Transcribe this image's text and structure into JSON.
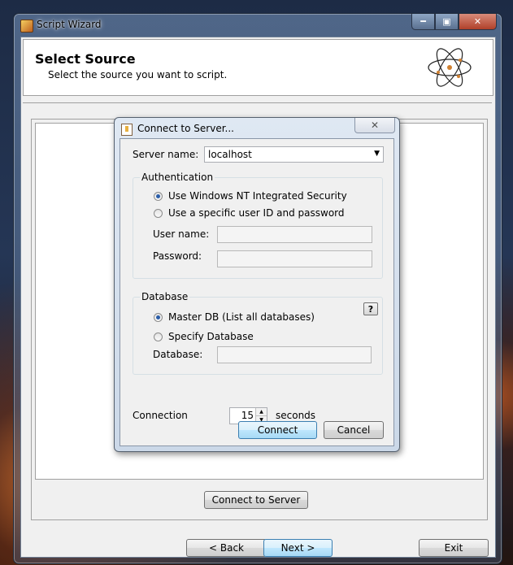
{
  "window": {
    "title": "Script Wizard",
    "minimize_glyph": "━",
    "maximize_glyph": "▣",
    "close_glyph": "✕"
  },
  "header": {
    "title": "Select Source",
    "subtitle": "Select the source you want to script.",
    "icon": "atom-icon"
  },
  "dialog": {
    "title": "Connect to Server...",
    "close_glyph": "✕",
    "server_name_label": "Server name:",
    "server_name_value": "localhost",
    "authentication": {
      "title": "Authentication",
      "option_windows": "Use Windows NT Integrated Security",
      "option_specific": "Use a specific user ID and password",
      "selected": "windows",
      "username_label": "User name:",
      "username_value": "",
      "password_label": "Password:",
      "password_value": ""
    },
    "database": {
      "title": "Database",
      "option_master": "Master DB (List all databases)",
      "option_specify": "Specify Database",
      "selected": "master",
      "database_label": "Database:",
      "database_value": "",
      "help_label": "?"
    },
    "connection": {
      "label": "Connection",
      "timeout_value": "15",
      "unit": "seconds"
    },
    "connect_button": "Connect",
    "cancel_button": "Cancel"
  },
  "main": {
    "connect_to_server_button": "Connect to Server"
  },
  "footer": {
    "back_button": "< Back",
    "next_button": "Next >",
    "exit_button": "Exit"
  },
  "colors": {
    "accent_default_button": "#3c7fb1",
    "dialog_frame": "#cbd8e8",
    "client_background": "#f0f0f0"
  }
}
